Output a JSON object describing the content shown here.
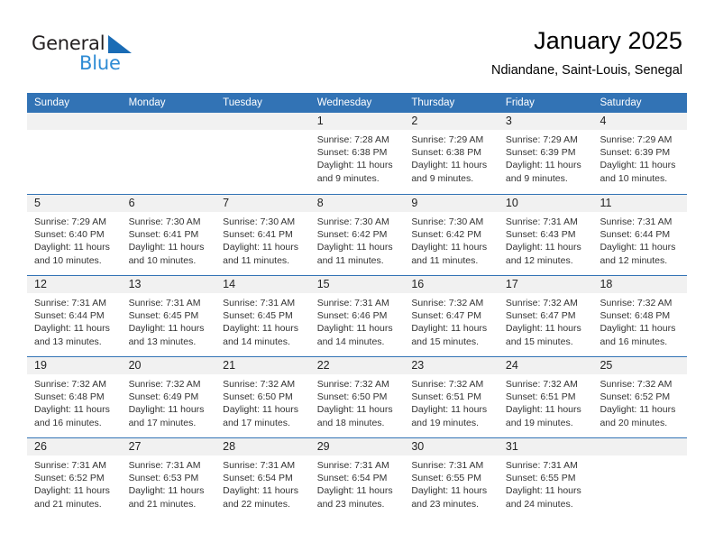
{
  "brand": {
    "name_part1": "General",
    "name_part2": "Blue",
    "accent_color": "#2e8bd4",
    "triangle_color": "#1a6cb5"
  },
  "header": {
    "title": "January 2025",
    "subtitle": "Ndiandane, Saint-Louis, Senegal"
  },
  "theme": {
    "header_row_bg": "#3273b5",
    "daynum_band_bg": "#f1f1f1",
    "row_separator": "#3273b5"
  },
  "weekdays": [
    "Sunday",
    "Monday",
    "Tuesday",
    "Wednesday",
    "Thursday",
    "Friday",
    "Saturday"
  ],
  "weeks": [
    [
      {
        "day": "",
        "sunrise": "",
        "sunset": "",
        "daylight": "",
        "daylight2": "",
        "empty": true
      },
      {
        "day": "",
        "sunrise": "",
        "sunset": "",
        "daylight": "",
        "daylight2": "",
        "empty": true
      },
      {
        "day": "",
        "sunrise": "",
        "sunset": "",
        "daylight": "",
        "daylight2": "",
        "empty": true
      },
      {
        "day": "1",
        "sunrise": "Sunrise: 7:28 AM",
        "sunset": "Sunset: 6:38 PM",
        "daylight": "Daylight: 11 hours",
        "daylight2": "and 9 minutes.",
        "empty": false
      },
      {
        "day": "2",
        "sunrise": "Sunrise: 7:29 AM",
        "sunset": "Sunset: 6:38 PM",
        "daylight": "Daylight: 11 hours",
        "daylight2": "and 9 minutes.",
        "empty": false
      },
      {
        "day": "3",
        "sunrise": "Sunrise: 7:29 AM",
        "sunset": "Sunset: 6:39 PM",
        "daylight": "Daylight: 11 hours",
        "daylight2": "and 9 minutes.",
        "empty": false
      },
      {
        "day": "4",
        "sunrise": "Sunrise: 7:29 AM",
        "sunset": "Sunset: 6:39 PM",
        "daylight": "Daylight: 11 hours",
        "daylight2": "and 10 minutes.",
        "empty": false
      }
    ],
    [
      {
        "day": "5",
        "sunrise": "Sunrise: 7:29 AM",
        "sunset": "Sunset: 6:40 PM",
        "daylight": "Daylight: 11 hours",
        "daylight2": "and 10 minutes.",
        "empty": false
      },
      {
        "day": "6",
        "sunrise": "Sunrise: 7:30 AM",
        "sunset": "Sunset: 6:41 PM",
        "daylight": "Daylight: 11 hours",
        "daylight2": "and 10 minutes.",
        "empty": false
      },
      {
        "day": "7",
        "sunrise": "Sunrise: 7:30 AM",
        "sunset": "Sunset: 6:41 PM",
        "daylight": "Daylight: 11 hours",
        "daylight2": "and 11 minutes.",
        "empty": false
      },
      {
        "day": "8",
        "sunrise": "Sunrise: 7:30 AM",
        "sunset": "Sunset: 6:42 PM",
        "daylight": "Daylight: 11 hours",
        "daylight2": "and 11 minutes.",
        "empty": false
      },
      {
        "day": "9",
        "sunrise": "Sunrise: 7:30 AM",
        "sunset": "Sunset: 6:42 PM",
        "daylight": "Daylight: 11 hours",
        "daylight2": "and 11 minutes.",
        "empty": false
      },
      {
        "day": "10",
        "sunrise": "Sunrise: 7:31 AM",
        "sunset": "Sunset: 6:43 PM",
        "daylight": "Daylight: 11 hours",
        "daylight2": "and 12 minutes.",
        "empty": false
      },
      {
        "day": "11",
        "sunrise": "Sunrise: 7:31 AM",
        "sunset": "Sunset: 6:44 PM",
        "daylight": "Daylight: 11 hours",
        "daylight2": "and 12 minutes.",
        "empty": false
      }
    ],
    [
      {
        "day": "12",
        "sunrise": "Sunrise: 7:31 AM",
        "sunset": "Sunset: 6:44 PM",
        "daylight": "Daylight: 11 hours",
        "daylight2": "and 13 minutes.",
        "empty": false
      },
      {
        "day": "13",
        "sunrise": "Sunrise: 7:31 AM",
        "sunset": "Sunset: 6:45 PM",
        "daylight": "Daylight: 11 hours",
        "daylight2": "and 13 minutes.",
        "empty": false
      },
      {
        "day": "14",
        "sunrise": "Sunrise: 7:31 AM",
        "sunset": "Sunset: 6:45 PM",
        "daylight": "Daylight: 11 hours",
        "daylight2": "and 14 minutes.",
        "empty": false
      },
      {
        "day": "15",
        "sunrise": "Sunrise: 7:31 AM",
        "sunset": "Sunset: 6:46 PM",
        "daylight": "Daylight: 11 hours",
        "daylight2": "and 14 minutes.",
        "empty": false
      },
      {
        "day": "16",
        "sunrise": "Sunrise: 7:32 AM",
        "sunset": "Sunset: 6:47 PM",
        "daylight": "Daylight: 11 hours",
        "daylight2": "and 15 minutes.",
        "empty": false
      },
      {
        "day": "17",
        "sunrise": "Sunrise: 7:32 AM",
        "sunset": "Sunset: 6:47 PM",
        "daylight": "Daylight: 11 hours",
        "daylight2": "and 15 minutes.",
        "empty": false
      },
      {
        "day": "18",
        "sunrise": "Sunrise: 7:32 AM",
        "sunset": "Sunset: 6:48 PM",
        "daylight": "Daylight: 11 hours",
        "daylight2": "and 16 minutes.",
        "empty": false
      }
    ],
    [
      {
        "day": "19",
        "sunrise": "Sunrise: 7:32 AM",
        "sunset": "Sunset: 6:48 PM",
        "daylight": "Daylight: 11 hours",
        "daylight2": "and 16 minutes.",
        "empty": false
      },
      {
        "day": "20",
        "sunrise": "Sunrise: 7:32 AM",
        "sunset": "Sunset: 6:49 PM",
        "daylight": "Daylight: 11 hours",
        "daylight2": "and 17 minutes.",
        "empty": false
      },
      {
        "day": "21",
        "sunrise": "Sunrise: 7:32 AM",
        "sunset": "Sunset: 6:50 PM",
        "daylight": "Daylight: 11 hours",
        "daylight2": "and 17 minutes.",
        "empty": false
      },
      {
        "day": "22",
        "sunrise": "Sunrise: 7:32 AM",
        "sunset": "Sunset: 6:50 PM",
        "daylight": "Daylight: 11 hours",
        "daylight2": "and 18 minutes.",
        "empty": false
      },
      {
        "day": "23",
        "sunrise": "Sunrise: 7:32 AM",
        "sunset": "Sunset: 6:51 PM",
        "daylight": "Daylight: 11 hours",
        "daylight2": "and 19 minutes.",
        "empty": false
      },
      {
        "day": "24",
        "sunrise": "Sunrise: 7:32 AM",
        "sunset": "Sunset: 6:51 PM",
        "daylight": "Daylight: 11 hours",
        "daylight2": "and 19 minutes.",
        "empty": false
      },
      {
        "day": "25",
        "sunrise": "Sunrise: 7:32 AM",
        "sunset": "Sunset: 6:52 PM",
        "daylight": "Daylight: 11 hours",
        "daylight2": "and 20 minutes.",
        "empty": false
      }
    ],
    [
      {
        "day": "26",
        "sunrise": "Sunrise: 7:31 AM",
        "sunset": "Sunset: 6:52 PM",
        "daylight": "Daylight: 11 hours",
        "daylight2": "and 21 minutes.",
        "empty": false
      },
      {
        "day": "27",
        "sunrise": "Sunrise: 7:31 AM",
        "sunset": "Sunset: 6:53 PM",
        "daylight": "Daylight: 11 hours",
        "daylight2": "and 21 minutes.",
        "empty": false
      },
      {
        "day": "28",
        "sunrise": "Sunrise: 7:31 AM",
        "sunset": "Sunset: 6:54 PM",
        "daylight": "Daylight: 11 hours",
        "daylight2": "and 22 minutes.",
        "empty": false
      },
      {
        "day": "29",
        "sunrise": "Sunrise: 7:31 AM",
        "sunset": "Sunset: 6:54 PM",
        "daylight": "Daylight: 11 hours",
        "daylight2": "and 23 minutes.",
        "empty": false
      },
      {
        "day": "30",
        "sunrise": "Sunrise: 7:31 AM",
        "sunset": "Sunset: 6:55 PM",
        "daylight": "Daylight: 11 hours",
        "daylight2": "and 23 minutes.",
        "empty": false
      },
      {
        "day": "31",
        "sunrise": "Sunrise: 7:31 AM",
        "sunset": "Sunset: 6:55 PM",
        "daylight": "Daylight: 11 hours",
        "daylight2": "and 24 minutes.",
        "empty": false
      },
      {
        "day": "",
        "sunrise": "",
        "sunset": "",
        "daylight": "",
        "daylight2": "",
        "empty": true
      }
    ]
  ]
}
